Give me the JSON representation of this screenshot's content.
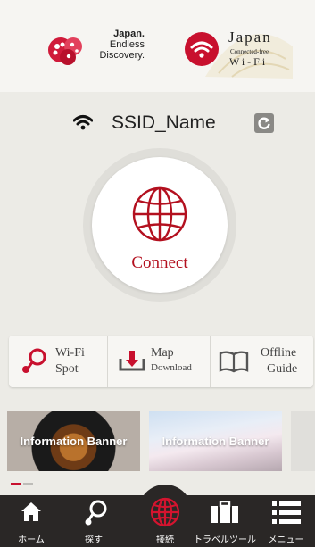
{
  "header": {
    "left_logo": {
      "line1": "Japan.",
      "line2": "Endless",
      "line3": "Discovery."
    },
    "right_logo": {
      "title": "Japan",
      "subtitle": "Connected-free",
      "wifi_text": "Wi-Fi"
    }
  },
  "network": {
    "ssid": "SSID_Name",
    "icon": "wifi-icon",
    "refresh_icon": "refresh-icon"
  },
  "connect": {
    "label": "Connect",
    "icon": "globe-icon"
  },
  "tools": [
    {
      "line1": "Wi-Fi",
      "line2": "Spot",
      "icon": "wifi-spot-icon"
    },
    {
      "line1": "Map",
      "line2": "Download",
      "icon": "download-icon"
    },
    {
      "line1": "Offline",
      "line2": "Guide",
      "icon": "book-icon"
    }
  ],
  "banners": [
    {
      "label": "Information Banner"
    },
    {
      "label": "Information Banner"
    }
  ],
  "pager": {
    "count": 2,
    "active_index": 0
  },
  "nav": [
    {
      "label": "ホーム",
      "icon": "home-icon"
    },
    {
      "label": "探す",
      "icon": "search-pin-icon"
    },
    {
      "label": "接続",
      "icon": "globe-icon"
    },
    {
      "label": "トラベルツール",
      "icon": "suitcase-icon"
    },
    {
      "label": "メニュー",
      "icon": "menu-icon"
    }
  ],
  "colors": {
    "brand_red": "#c8102e",
    "connect_text": "#b3101f",
    "nav_bg": "#2a2726",
    "page_bg": "#ecebe6"
  }
}
